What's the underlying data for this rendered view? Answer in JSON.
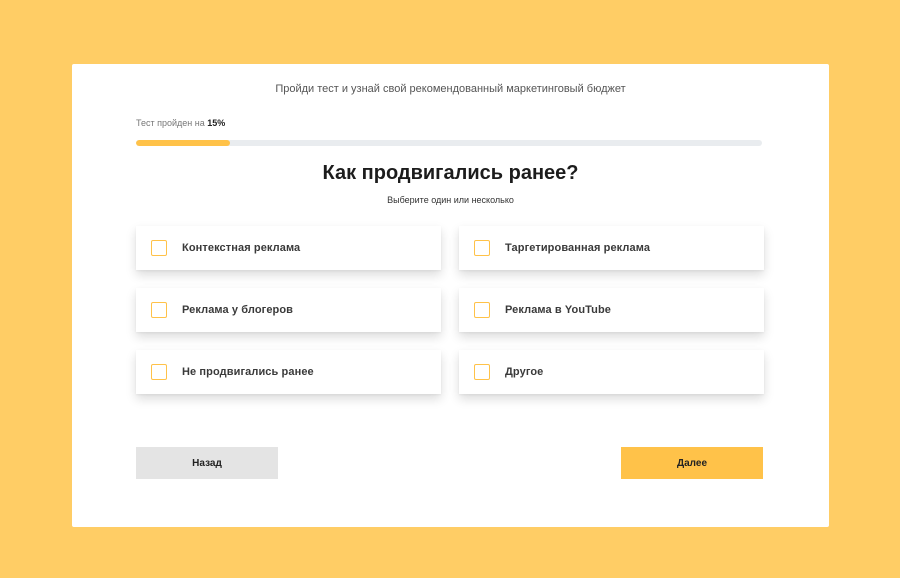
{
  "header": {
    "subtitle": "Пройди тест и узнай свой рекомендованный маркетинговый бюджет"
  },
  "progress": {
    "label": "Тест пройден на",
    "value_text": "15%",
    "percent": 15
  },
  "question": {
    "title": "Как продвигались ранее?",
    "hint": "Выберите один или несколько"
  },
  "options": [
    {
      "label": "Контекстная реклама",
      "checked": false
    },
    {
      "label": "Таргетированная реклама",
      "checked": false
    },
    {
      "label": "Реклама у блогеров",
      "checked": false
    },
    {
      "label": "Реклама в YouTube",
      "checked": false
    },
    {
      "label": "Не продвигались ранее",
      "checked": false
    },
    {
      "label": "Другое",
      "checked": false
    }
  ],
  "buttons": {
    "back_label": "Назад",
    "next_label": "Далее"
  },
  "colors": {
    "background": "#FFCD65",
    "accent": "#FFC249",
    "track": "#E9ECEF",
    "back_button": "#E4E4E4"
  }
}
